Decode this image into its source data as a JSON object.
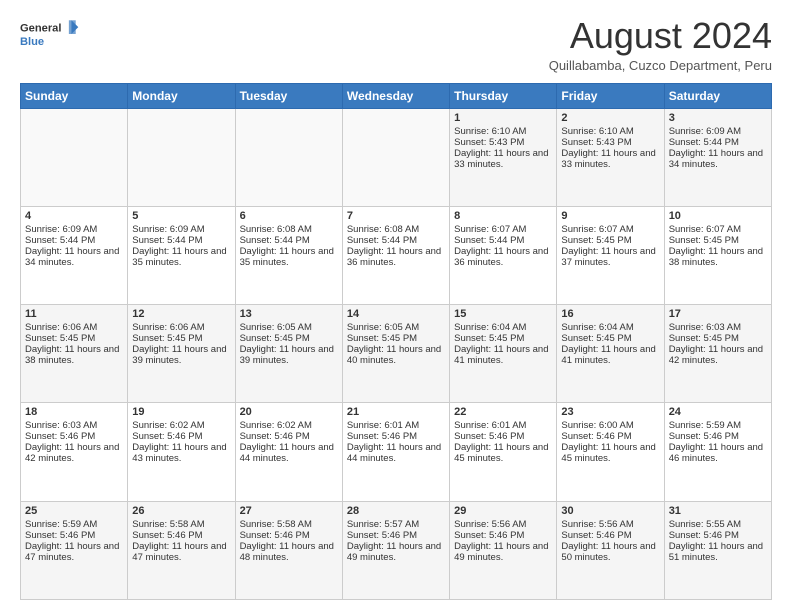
{
  "header": {
    "logo_general": "General",
    "logo_blue": "Blue",
    "month_year": "August 2024",
    "location": "Quillabamba, Cuzco Department, Peru"
  },
  "days_of_week": [
    "Sunday",
    "Monday",
    "Tuesday",
    "Wednesday",
    "Thursday",
    "Friday",
    "Saturday"
  ],
  "weeks": [
    [
      {
        "day": "",
        "data": ""
      },
      {
        "day": "",
        "data": ""
      },
      {
        "day": "",
        "data": ""
      },
      {
        "day": "",
        "data": ""
      },
      {
        "day": "1",
        "sunrise": "6:10 AM",
        "sunset": "5:43 PM",
        "daylight": "11 hours and 33 minutes."
      },
      {
        "day": "2",
        "sunrise": "6:10 AM",
        "sunset": "5:43 PM",
        "daylight": "11 hours and 33 minutes."
      },
      {
        "day": "3",
        "sunrise": "6:09 AM",
        "sunset": "5:44 PM",
        "daylight": "11 hours and 34 minutes."
      }
    ],
    [
      {
        "day": "4",
        "sunrise": "6:09 AM",
        "sunset": "5:44 PM",
        "daylight": "11 hours and 34 minutes."
      },
      {
        "day": "5",
        "sunrise": "6:09 AM",
        "sunset": "5:44 PM",
        "daylight": "11 hours and 35 minutes."
      },
      {
        "day": "6",
        "sunrise": "6:08 AM",
        "sunset": "5:44 PM",
        "daylight": "11 hours and 35 minutes."
      },
      {
        "day": "7",
        "sunrise": "6:08 AM",
        "sunset": "5:44 PM",
        "daylight": "11 hours and 36 minutes."
      },
      {
        "day": "8",
        "sunrise": "6:07 AM",
        "sunset": "5:44 PM",
        "daylight": "11 hours and 36 minutes."
      },
      {
        "day": "9",
        "sunrise": "6:07 AM",
        "sunset": "5:45 PM",
        "daylight": "11 hours and 37 minutes."
      },
      {
        "day": "10",
        "sunrise": "6:07 AM",
        "sunset": "5:45 PM",
        "daylight": "11 hours and 38 minutes."
      }
    ],
    [
      {
        "day": "11",
        "sunrise": "6:06 AM",
        "sunset": "5:45 PM",
        "daylight": "11 hours and 38 minutes."
      },
      {
        "day": "12",
        "sunrise": "6:06 AM",
        "sunset": "5:45 PM",
        "daylight": "11 hours and 39 minutes."
      },
      {
        "day": "13",
        "sunrise": "6:05 AM",
        "sunset": "5:45 PM",
        "daylight": "11 hours and 39 minutes."
      },
      {
        "day": "14",
        "sunrise": "6:05 AM",
        "sunset": "5:45 PM",
        "daylight": "11 hours and 40 minutes."
      },
      {
        "day": "15",
        "sunrise": "6:04 AM",
        "sunset": "5:45 PM",
        "daylight": "11 hours and 41 minutes."
      },
      {
        "day": "16",
        "sunrise": "6:04 AM",
        "sunset": "5:45 PM",
        "daylight": "11 hours and 41 minutes."
      },
      {
        "day": "17",
        "sunrise": "6:03 AM",
        "sunset": "5:45 PM",
        "daylight": "11 hours and 42 minutes."
      }
    ],
    [
      {
        "day": "18",
        "sunrise": "6:03 AM",
        "sunset": "5:46 PM",
        "daylight": "11 hours and 42 minutes."
      },
      {
        "day": "19",
        "sunrise": "6:02 AM",
        "sunset": "5:46 PM",
        "daylight": "11 hours and 43 minutes."
      },
      {
        "day": "20",
        "sunrise": "6:02 AM",
        "sunset": "5:46 PM",
        "daylight": "11 hours and 44 minutes."
      },
      {
        "day": "21",
        "sunrise": "6:01 AM",
        "sunset": "5:46 PM",
        "daylight": "11 hours and 44 minutes."
      },
      {
        "day": "22",
        "sunrise": "6:01 AM",
        "sunset": "5:46 PM",
        "daylight": "11 hours and 45 minutes."
      },
      {
        "day": "23",
        "sunrise": "6:00 AM",
        "sunset": "5:46 PM",
        "daylight": "11 hours and 45 minutes."
      },
      {
        "day": "24",
        "sunrise": "5:59 AM",
        "sunset": "5:46 PM",
        "daylight": "11 hours and 46 minutes."
      }
    ],
    [
      {
        "day": "25",
        "sunrise": "5:59 AM",
        "sunset": "5:46 PM",
        "daylight": "11 hours and 47 minutes."
      },
      {
        "day": "26",
        "sunrise": "5:58 AM",
        "sunset": "5:46 PM",
        "daylight": "11 hours and 47 minutes."
      },
      {
        "day": "27",
        "sunrise": "5:58 AM",
        "sunset": "5:46 PM",
        "daylight": "11 hours and 48 minutes."
      },
      {
        "day": "28",
        "sunrise": "5:57 AM",
        "sunset": "5:46 PM",
        "daylight": "11 hours and 49 minutes."
      },
      {
        "day": "29",
        "sunrise": "5:56 AM",
        "sunset": "5:46 PM",
        "daylight": "11 hours and 49 minutes."
      },
      {
        "day": "30",
        "sunrise": "5:56 AM",
        "sunset": "5:46 PM",
        "daylight": "11 hours and 50 minutes."
      },
      {
        "day": "31",
        "sunrise": "5:55 AM",
        "sunset": "5:46 PM",
        "daylight": "11 hours and 51 minutes."
      }
    ]
  ]
}
